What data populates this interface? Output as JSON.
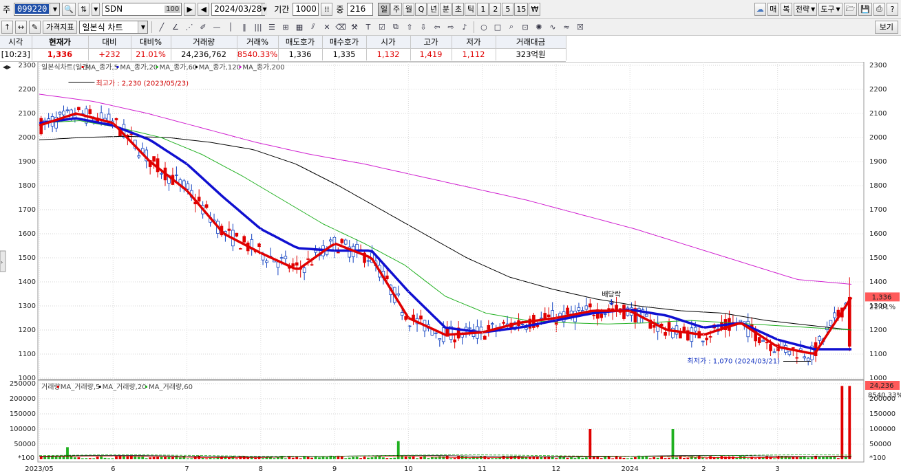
{
  "toolbar1": {
    "market_label": "주",
    "code": "099220",
    "name": "SDN",
    "name_num": "100",
    "date": "2024/03/28",
    "period_label": "기간",
    "period_value": "1000",
    "count_label": "중",
    "count_value": "216",
    "interval_tabs": [
      "일",
      "주",
      "월",
      "Q",
      "년",
      "분",
      "초",
      "틱",
      "1",
      "2",
      "5",
      "15",
      "₩"
    ],
    "active_tab": "일",
    "right_buttons": [
      "매",
      "복",
      "전략",
      "도구"
    ]
  },
  "toolbar2": {
    "price_indicator": "가격지표",
    "chart_type": "일본식 차트",
    "view_button": "보기"
  },
  "info": {
    "headers": [
      "시각",
      "현재가",
      "대비",
      "대비%",
      "거래량",
      "거래%",
      "매도호가",
      "매수호가",
      "시가",
      "고가",
      "저가",
      "거래대금"
    ],
    "values": [
      "[10:23]",
      "1,336",
      "+232",
      "21.01%",
      "24,236,762",
      "8540.33%",
      "1,336",
      "1,335",
      "1,132",
      "1,419",
      "1,112",
      "323억원"
    ]
  },
  "price_panel": {
    "legend": [
      {
        "label": "일본식차트(일간)",
        "color": "#444444"
      },
      {
        "label": "MA_종가,5",
        "color": "#e00000"
      },
      {
        "label": "MA_종가,20",
        "color": "#1010d0"
      },
      {
        "label": "MA_종가,60",
        "color": "#20b020"
      },
      {
        "label": "MA_종가,120",
        "color": "#000000"
      },
      {
        "label": "MA_종가,200",
        "color": "#d020d0"
      }
    ],
    "y_ticks": [
      2300,
      2200,
      2100,
      2000,
      1900,
      1800,
      1700,
      1600,
      1500,
      1400,
      1300,
      1200,
      1100,
      1000
    ],
    "high_label": "최고가 : 2,230 (2023/05/23)",
    "low_label": "최저가 : 1,070 (2024/03/21)",
    "dividend_label": "배당락",
    "current_price_tag": "1,336",
    "current_change_tag": "21.01%"
  },
  "volume_panel": {
    "legend": [
      {
        "label": "거래량",
        "color": "#444444"
      },
      {
        "label": "MA_거래량,5",
        "color": "#e00000"
      },
      {
        "label": "MA_거래량,20",
        "color": "#000000"
      },
      {
        "label": "MA_거래량,60",
        "color": "#20b020"
      }
    ],
    "y_ticks": [
      "250000",
      "200000",
      "150000",
      "100000",
      "50000"
    ],
    "unit_label": "*100",
    "current_volume_tag": "24,236",
    "current_pct_tag": "8540.33%"
  },
  "x_labels": [
    "2023/05",
    "6",
    "7",
    "8",
    "9",
    "10",
    "11",
    "12",
    "2024",
    "2",
    "3"
  ],
  "colors": {
    "up": "#e00000",
    "down": "#1040c0",
    "ma5": "#e00000",
    "ma20": "#1010d0",
    "ma60": "#20b020",
    "ma120": "#000000",
    "ma200": "#d020d0"
  },
  "chart_data": {
    "type": "candlestick",
    "price_axis": {
      "ylim": [
        1000,
        2300
      ]
    },
    "volume_axis": {
      "ylim": [
        0,
        250000
      ],
      "unit": "*100"
    },
    "month_labels": [
      "2023/05",
      "6",
      "7",
      "8",
      "9",
      "10",
      "11",
      "12",
      "2024",
      "2",
      "3"
    ],
    "close_path_monthly": [
      2050,
      2100,
      2060,
      1900,
      1780,
      1600,
      1520,
      1450,
      1560,
      1500,
      1250,
      1180,
      1190,
      1230,
      1250,
      1280,
      1280,
      1200,
      1180,
      1230,
      1130,
      1100,
      1336
    ],
    "ma20_path": [
      2060,
      2080,
      2050,
      1990,
      1890,
      1750,
      1620,
      1540,
      1530,
      1530,
      1360,
      1210,
      1190,
      1210,
      1240,
      1270,
      1285,
      1260,
      1210,
      1230,
      1160,
      1120,
      1120
    ],
    "ma60_path": [
      2060,
      2070,
      2040,
      2000,
      1930,
      1840,
      1740,
      1640,
      1560,
      1470,
      1340,
      1270,
      1240,
      1230,
      1225,
      1230,
      1240,
      1230,
      1220,
      1210,
      1200
    ],
    "ma120_path": [
      1990,
      2000,
      2005,
      2000,
      1980,
      1950,
      1890,
      1800,
      1700,
      1600,
      1500,
      1420,
      1370,
      1330,
      1300,
      1280,
      1270,
      1240,
      1220,
      1200
    ],
    "ma200_path": [
      2180,
      2150,
      2100,
      2040,
      1980,
      1930,
      1890,
      1840,
      1790,
      1740,
      1680,
      1620,
      1550,
      1480,
      1410,
      1390
    ],
    "high": 2230,
    "low": 1070,
    "current": 1336,
    "volume_spikes": [
      {
        "month_pos": 0.35,
        "value": 40000
      },
      {
        "month_pos": 4.85,
        "value": 60000
      },
      {
        "month_pos": 7.45,
        "value": 100000
      },
      {
        "month_pos": 8.55,
        "value": 100000
      },
      {
        "month_pos": 10.85,
        "value": 242367
      }
    ]
  }
}
